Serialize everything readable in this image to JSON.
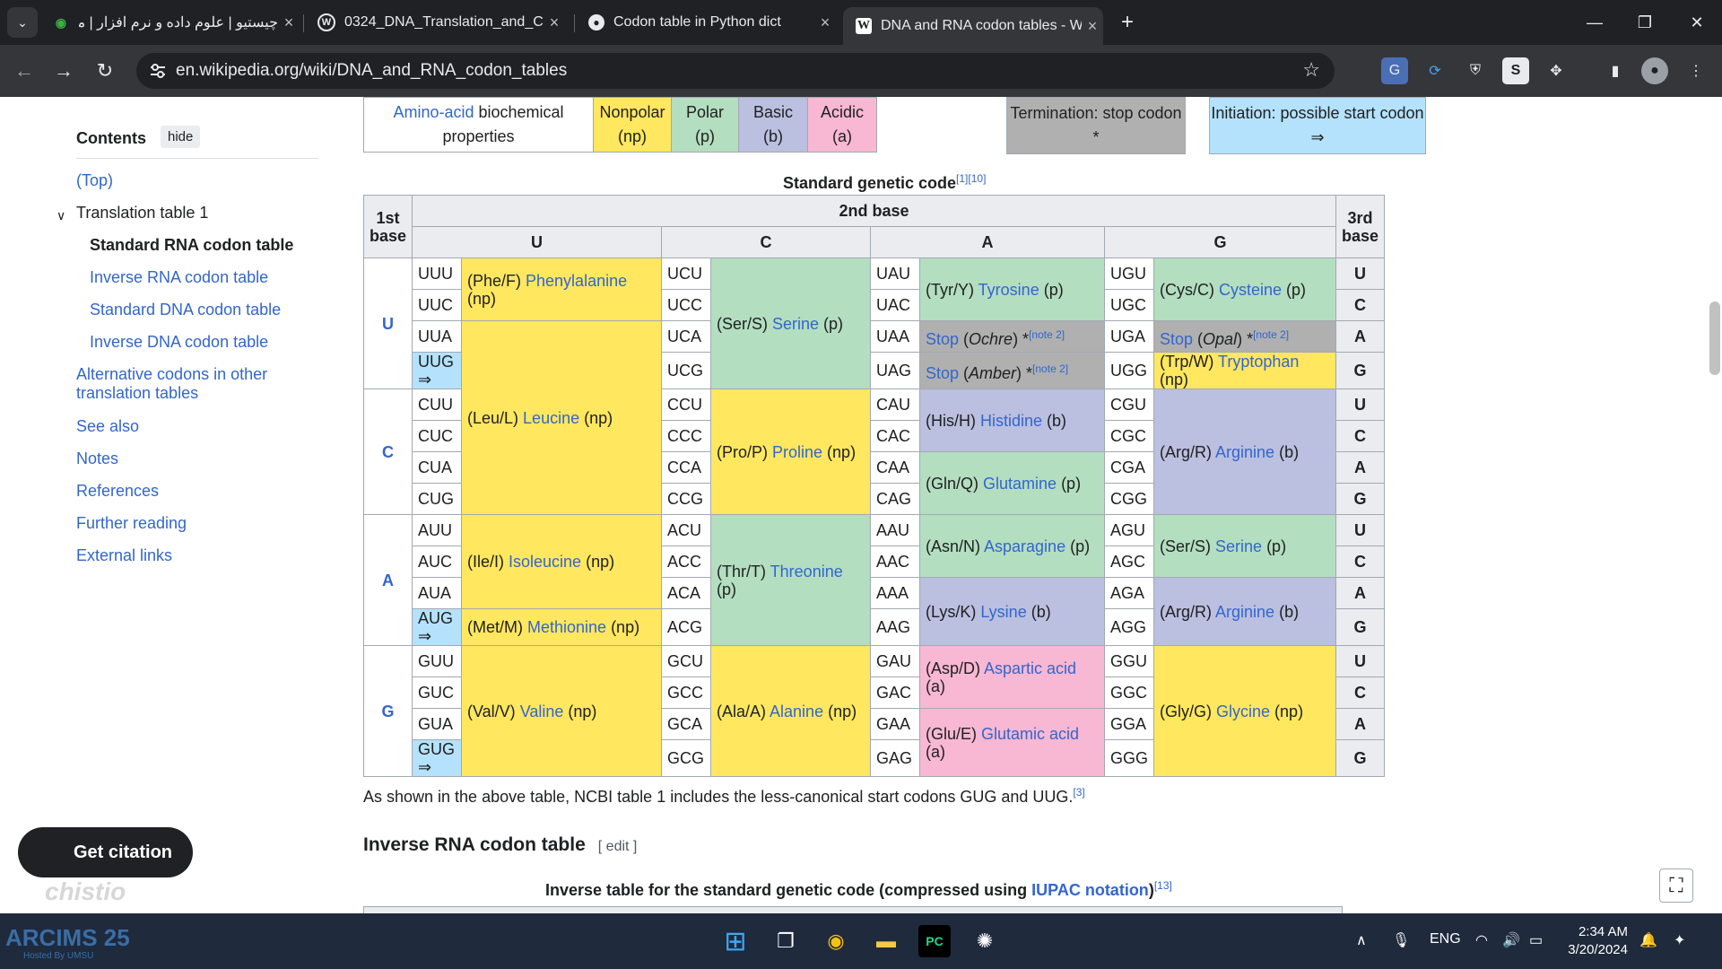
{
  "browser": {
    "tabs": [
      {
        "title": "چیستیو | علوم داده و نرم افزار | مـ",
        "active": false
      },
      {
        "title": "0324_DNA_Translation_and_Co",
        "active": false
      },
      {
        "title": "Codon table in Python dict",
        "active": false
      },
      {
        "title": "DNA and RNA codon tables - W",
        "active": true
      }
    ],
    "url": "en.wikipedia.org/wiki/DNA_and_RNA_codon_tables"
  },
  "toc": {
    "title": "Contents",
    "hide_label": "hide",
    "items": [
      "(Top)",
      "Translation table 1",
      "Standard RNA codon table",
      "Inverse RNA codon table",
      "Standard DNA codon table",
      "Inverse DNA codon table",
      "Alternative codons in other translation tables",
      "See also",
      "Notes",
      "References",
      "Further reading",
      "External links"
    ]
  },
  "legend": {
    "aa_link": "Amino-acid",
    "aa_text": " biochemical properties",
    "nonpolar": "Nonpolar (np)",
    "polar": "Polar (p)",
    "basic": "Basic (b)",
    "acidic": "Acidic (a)",
    "termination": "Termination: stop codon *",
    "initiation": "Initiation: possible start codon ⇒"
  },
  "table": {
    "caption": "Standard genetic code",
    "caption_refs": "[1][10]",
    "h_first": "1st base",
    "h_second": "2nd base",
    "h_third": "3rd base",
    "bases": [
      "U",
      "C",
      "A",
      "G"
    ]
  },
  "paragraph": {
    "text": "As shown in the above table, NCBI table 1 includes the less-canonical start codons GUG and UUG.",
    "ref": "[3]"
  },
  "section": {
    "title": "Inverse RNA codon table",
    "edit": "[ edit ]",
    "inverse_caption": "Inverse table for the standard genetic code (compressed using ",
    "inverse_link": "IUPAC notation",
    "inverse_close": ")",
    "inverse_ref": "[13]"
  },
  "cite_button": "Get citation",
  "watermark": "chistio",
  "taskbar": {
    "logo": "ARCIMS 25",
    "logo_sub": "Hosted By UMSU",
    "lang": "ENG",
    "time": "2:34 AM",
    "date": "3/20/2024"
  }
}
